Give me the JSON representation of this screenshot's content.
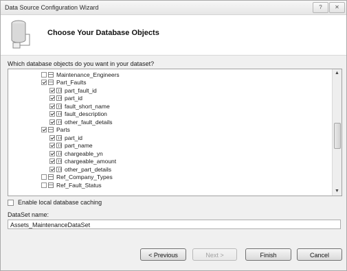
{
  "window": {
    "title": "Data Source Configuration Wizard",
    "help_label": "?",
    "close_label": "✕"
  },
  "header": {
    "title": "Choose Your Database Objects"
  },
  "question": "Which database objects do you want in your dataset?",
  "tree": {
    "rows": [
      {
        "label": "Maintenance_Engineers",
        "checked": false,
        "kind": "table",
        "level": 1
      },
      {
        "label": "Part_Faults",
        "checked": true,
        "kind": "table",
        "level": 1
      },
      {
        "label": "part_fault_id",
        "checked": true,
        "kind": "column",
        "level": 2
      },
      {
        "label": "part_id",
        "checked": true,
        "kind": "column",
        "level": 2
      },
      {
        "label": "fault_short_name",
        "checked": true,
        "kind": "column",
        "level": 2
      },
      {
        "label": "fault_description",
        "checked": true,
        "kind": "column",
        "level": 2
      },
      {
        "label": "other_fault_details",
        "checked": true,
        "kind": "column",
        "level": 2
      },
      {
        "label": "Parts",
        "checked": true,
        "kind": "table",
        "level": 1
      },
      {
        "label": "part_id",
        "checked": true,
        "kind": "column",
        "level": 2
      },
      {
        "label": "part_name",
        "checked": true,
        "kind": "column",
        "level": 2
      },
      {
        "label": "chargeable_yn",
        "checked": true,
        "kind": "column",
        "level": 2
      },
      {
        "label": "chargeable_amount",
        "checked": true,
        "kind": "column",
        "level": 2
      },
      {
        "label": "other_part_details",
        "checked": true,
        "kind": "column",
        "level": 2
      },
      {
        "label": "Ref_Company_Types",
        "checked": false,
        "kind": "table",
        "level": 1
      },
      {
        "label": "Ref_Fault_Status",
        "checked": false,
        "kind": "table",
        "level": 1
      }
    ]
  },
  "enable_caching": {
    "label": "Enable local database caching",
    "checked": false
  },
  "dataset": {
    "label": "DataSet name:",
    "value": "Assets_MaintenanceDataSet"
  },
  "buttons": {
    "previous": "< Previous",
    "next": "Next >",
    "finish": "Finish",
    "cancel": "Cancel"
  }
}
